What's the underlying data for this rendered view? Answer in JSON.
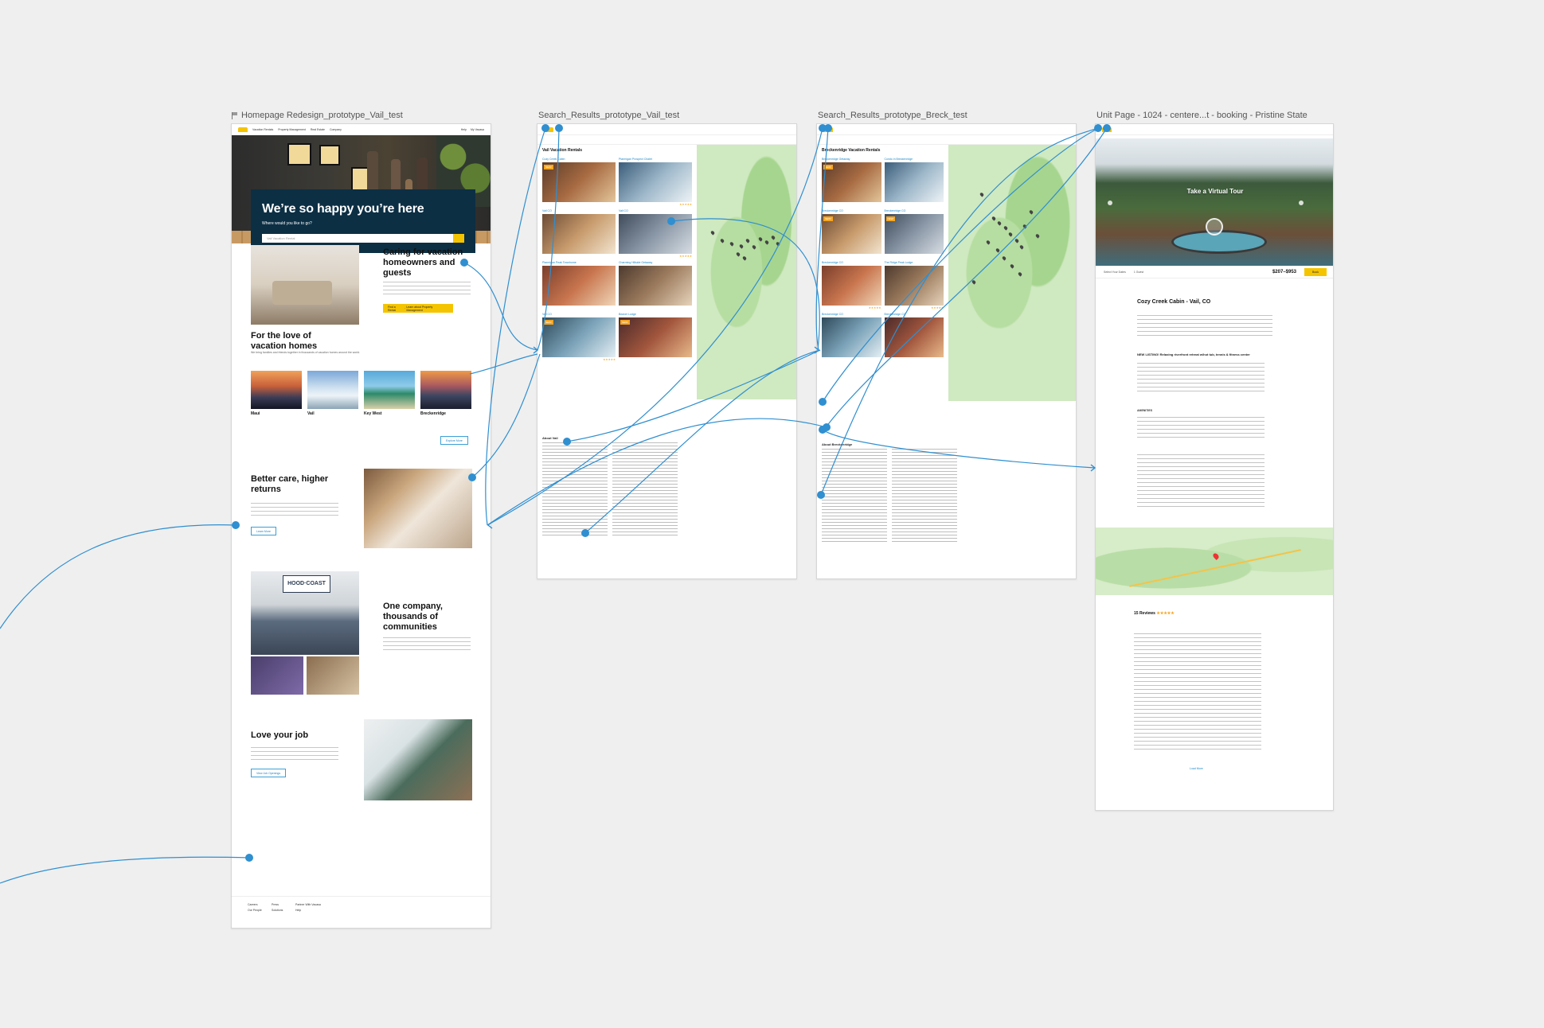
{
  "frames": {
    "homepage": {
      "title": "Homepage Redesign_prototype_Vail_test",
      "nav": [
        "Vacation Rentals",
        "Property Management",
        "Real Estate",
        "Company"
      ],
      "nav_right": [
        "Help",
        "My Vacasa"
      ],
      "hero_heading": "We’re so happy you’re here",
      "hero_sub": "Where would you like to go?",
      "search_placeholder": "Vail Vacation Rental",
      "s1_title": "Caring for vacation homeowners and guests",
      "s1_button": "Find a Rental",
      "s1_button2": "Learn about Property Management",
      "s2_title": "For the love of vacation homes",
      "s2_body": "We bring families and friends together in thousands of vacation homes around the world.",
      "destinations": [
        "Maui",
        "Vail",
        "Key West",
        "Breckenridge"
      ],
      "explore_button": "Explore More",
      "s3_title": "Better care, higher returns",
      "s3_button": "Learn More",
      "s4_title": "One company, thousands of communities",
      "logo_text": "HOOD·COAST",
      "s5_title": "Love your job",
      "s5_button": "View Job Openings",
      "footer_links": [
        "Careers",
        "Our People",
        "Press",
        "Solutions",
        "Partner With Vacasa",
        "Help"
      ]
    },
    "search_vail": {
      "title": "Search_Results_prototype_Vail_test",
      "heading": "Vail Vacation Rentals",
      "listings": [
        {
          "name": "Cozy Creek Cabin",
          "tag": "NEW!",
          "rating": ""
        },
        {
          "name": "Ptarmigan Prospect Chalet",
          "tag": "",
          "rating": "★★★★★"
        },
        {
          "name": "Vail CO",
          "tag": "",
          "rating": ""
        },
        {
          "name": "Vail CO",
          "tag": "",
          "rating": "★★★★★"
        },
        {
          "name": "Ptarmigan Peak Townhome",
          "tag": "",
          "rating": ""
        },
        {
          "name": "Charming Hillside Getaway",
          "tag": "",
          "rating": ""
        },
        {
          "name": "Vail CO",
          "tag": "NEW!",
          "rating": "★★★★★"
        },
        {
          "name": "Beaver Lodge",
          "tag": "NEW!",
          "rating": ""
        }
      ],
      "article_heading": "About Vail"
    },
    "search_breck": {
      "title": "Search_Results_prototype_Breck_test",
      "heading": "Breckenridge Vacation Rentals",
      "listings": [
        {
          "name": "Breckenridge Getaway",
          "tag": "NEW!",
          "rating": ""
        },
        {
          "name": "Condo in Breckenridge",
          "tag": "",
          "rating": ""
        },
        {
          "name": "Breckenridge CO",
          "tag": "NEW!",
          "rating": ""
        },
        {
          "name": "Breckenridge CO",
          "tag": "NEW!",
          "rating": ""
        },
        {
          "name": "Breckenridge CO",
          "tag": "",
          "rating": "★★★★★"
        },
        {
          "name": "The Ridge Peak Lodge",
          "tag": "",
          "rating": "★★★★★"
        },
        {
          "name": "Breckenridge CO",
          "tag": "",
          "rating": ""
        },
        {
          "name": "Breckenridge CO",
          "tag": "",
          "rating": ""
        }
      ],
      "article_heading": "About Breckenridge"
    },
    "unit": {
      "title": "Unit Page - 1024 - centere...t - booking  - Pristine State",
      "tour_label": "Take a Virtual Tour",
      "price_range": "$207–$953",
      "book_label": "Book",
      "guests_label": "1 Guest",
      "dates_label": "Select Your Dates",
      "unit_name": "Cozy Creek Cabin - Vail, CO",
      "listing_heading": "NEW LISTING! Relaxing riverfront retreat w/hot tub, tennis & fitness center",
      "amenities_label": "AMENITIES",
      "reviews_count": "15 Reviews",
      "stars": "★★★★★",
      "more_reviews": "Load More"
    }
  },
  "colors": {
    "accent": "#f5c400",
    "navy": "#0c2f44",
    "link": "#1a87c8",
    "connector": "#2f8fd0"
  }
}
